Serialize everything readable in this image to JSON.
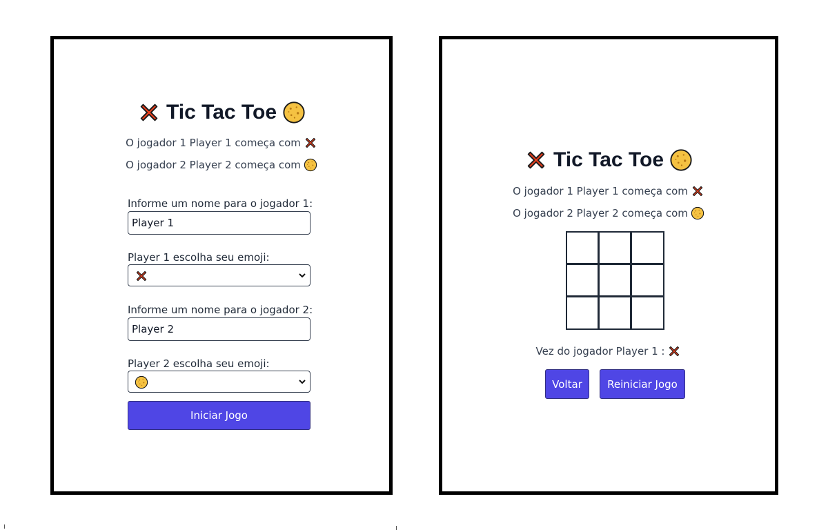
{
  "setup_screen": {
    "title": "Tic Tac Toe",
    "title_icon_left": "cross-mark-icon",
    "title_icon_right": "cookie-icon",
    "player1_info": "O jogador 1 Player 1 começa com",
    "player1_info_icon": "cross-mark-icon",
    "player2_info": "O jogador 2 Player 2 começa com",
    "player2_info_icon": "cookie-icon",
    "player1_name_label": "Informe um nome para o jogador 1:",
    "player1_name_value": "Player 1",
    "player1_emoji_label": "Player 1 escolha seu emoji:",
    "player1_emoji_selected": "❌",
    "player2_name_label": "Informe um nome para o jogador 2:",
    "player2_name_value": "Player 2",
    "player2_emoji_label": "Player 2 escolha seu emoji:",
    "player2_emoji_selected": "🍪",
    "start_button_label": "Iniciar Jogo"
  },
  "game_screen": {
    "title": "Tic Tac Toe",
    "title_icon_left": "cross-mark-icon",
    "title_icon_right": "cookie-icon",
    "player1_info": "O jogador 1 Player 1 começa com",
    "player2_info": "O jogador 2 Player 2 começa com",
    "board": [
      "",
      "",
      "",
      "",
      "",
      "",
      "",
      "",
      ""
    ],
    "turn_text": "Vez do jogador Player 1 :",
    "turn_icon": "cross-mark-icon",
    "back_button_label": "Voltar",
    "restart_button_label": "Reiniciar Jogo"
  },
  "colors": {
    "accent": "#4f46e5",
    "frame": "#000000",
    "cross": "#e53d1c",
    "cookie": "#f5c242"
  }
}
